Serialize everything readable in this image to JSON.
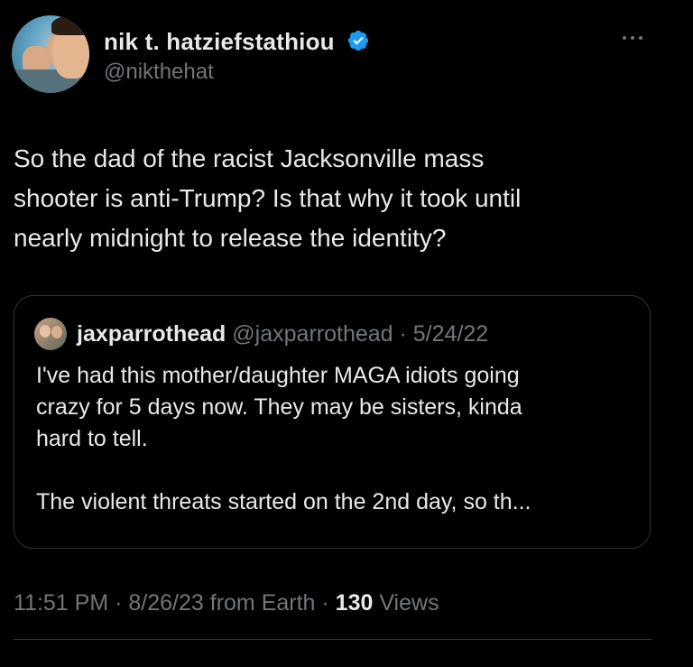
{
  "author": {
    "display_name": "nik t. hatziefstathiou",
    "handle": "@nikthehat",
    "verified": true
  },
  "tweet": {
    "text": "So the dad of the racist Jacksonville mass\nshooter is anti-Trump? Is that why it took until\nnearly midnight to release the identity?"
  },
  "quoted_tweet": {
    "display_name": "jaxparrothead",
    "handle": "@jaxparrothead",
    "separator": " · ",
    "date": "5/24/22",
    "text": "I've had this mother/daughter MAGA idiots going\ncrazy for 5 days now. They may be sisters, kinda\nhard to tell.\n\nThe violent threats started on the 2nd day, so th..."
  },
  "meta": {
    "time": "11:51 PM",
    "sep1": " · ",
    "date": "8/26/23",
    "source": " from Earth",
    "sep2": " · ",
    "views_count": "130",
    "views_label": " Views"
  },
  "icons": {
    "verified": "verified-badge-icon",
    "more": "more-horizontal-icon"
  },
  "colors": {
    "background": "#000000",
    "text_primary": "#e7e9ea",
    "text_secondary": "#71767b",
    "border": "#2f3336",
    "verified_blue": "#1d9bf0"
  }
}
